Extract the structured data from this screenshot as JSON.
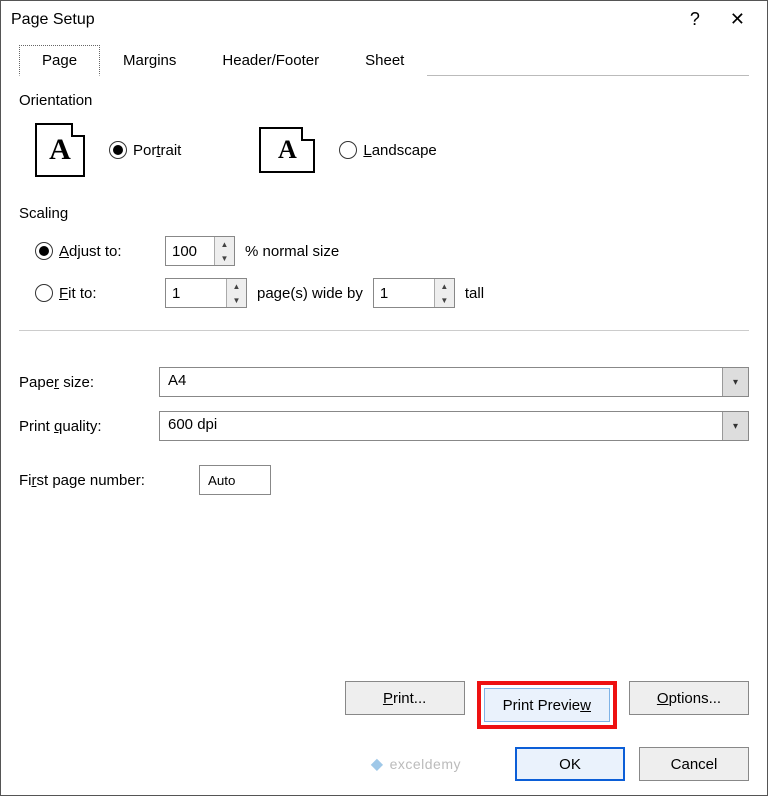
{
  "title": "Page Setup",
  "titlebar": {
    "help": "?",
    "close": "✕"
  },
  "tabs": [
    {
      "label": "Page",
      "active": true
    },
    {
      "label": "Margins",
      "active": false
    },
    {
      "label": "Header/Footer",
      "active": false
    },
    {
      "label": "Sheet",
      "active": false
    }
  ],
  "orientation": {
    "label": "Orientation",
    "portrait_label_pre": "Por",
    "portrait_label_u": "t",
    "portrait_label_post": "rait",
    "landscape_label_u": "L",
    "landscape_label_post": "andscape",
    "selected": "portrait",
    "iconA": "A"
  },
  "scaling": {
    "label": "Scaling",
    "adjust_label_u": "A",
    "adjust_label_post": "djust to:",
    "adjust_value": "100",
    "adjust_suffix": "% normal size",
    "fit_label_u": "F",
    "fit_label_post": "it to:",
    "fit_wide": "1",
    "fit_mid": "page(s) wide by",
    "fit_tall": "1",
    "fit_suffix": "tall",
    "selected": "adjust"
  },
  "paper": {
    "size_label_pre": "Pape",
    "size_label_u": "r",
    "size_label_post": " size:",
    "size_value": "A4",
    "quality_label_pre": "Print ",
    "quality_label_u": "q",
    "quality_label_post": "uality:",
    "quality_value": "600 dpi",
    "firstpage_label_pre": "Fi",
    "firstpage_label_u": "r",
    "firstpage_label_post": "st page number:",
    "firstpage_value": "Auto"
  },
  "buttons": {
    "print_u": "P",
    "print_post": "rint...",
    "preview_pre": "Print Previe",
    "preview_u": "w",
    "options_u": "O",
    "options_post": "ptions...",
    "ok": "OK",
    "cancel": "Cancel"
  },
  "watermark": "exceldemy"
}
